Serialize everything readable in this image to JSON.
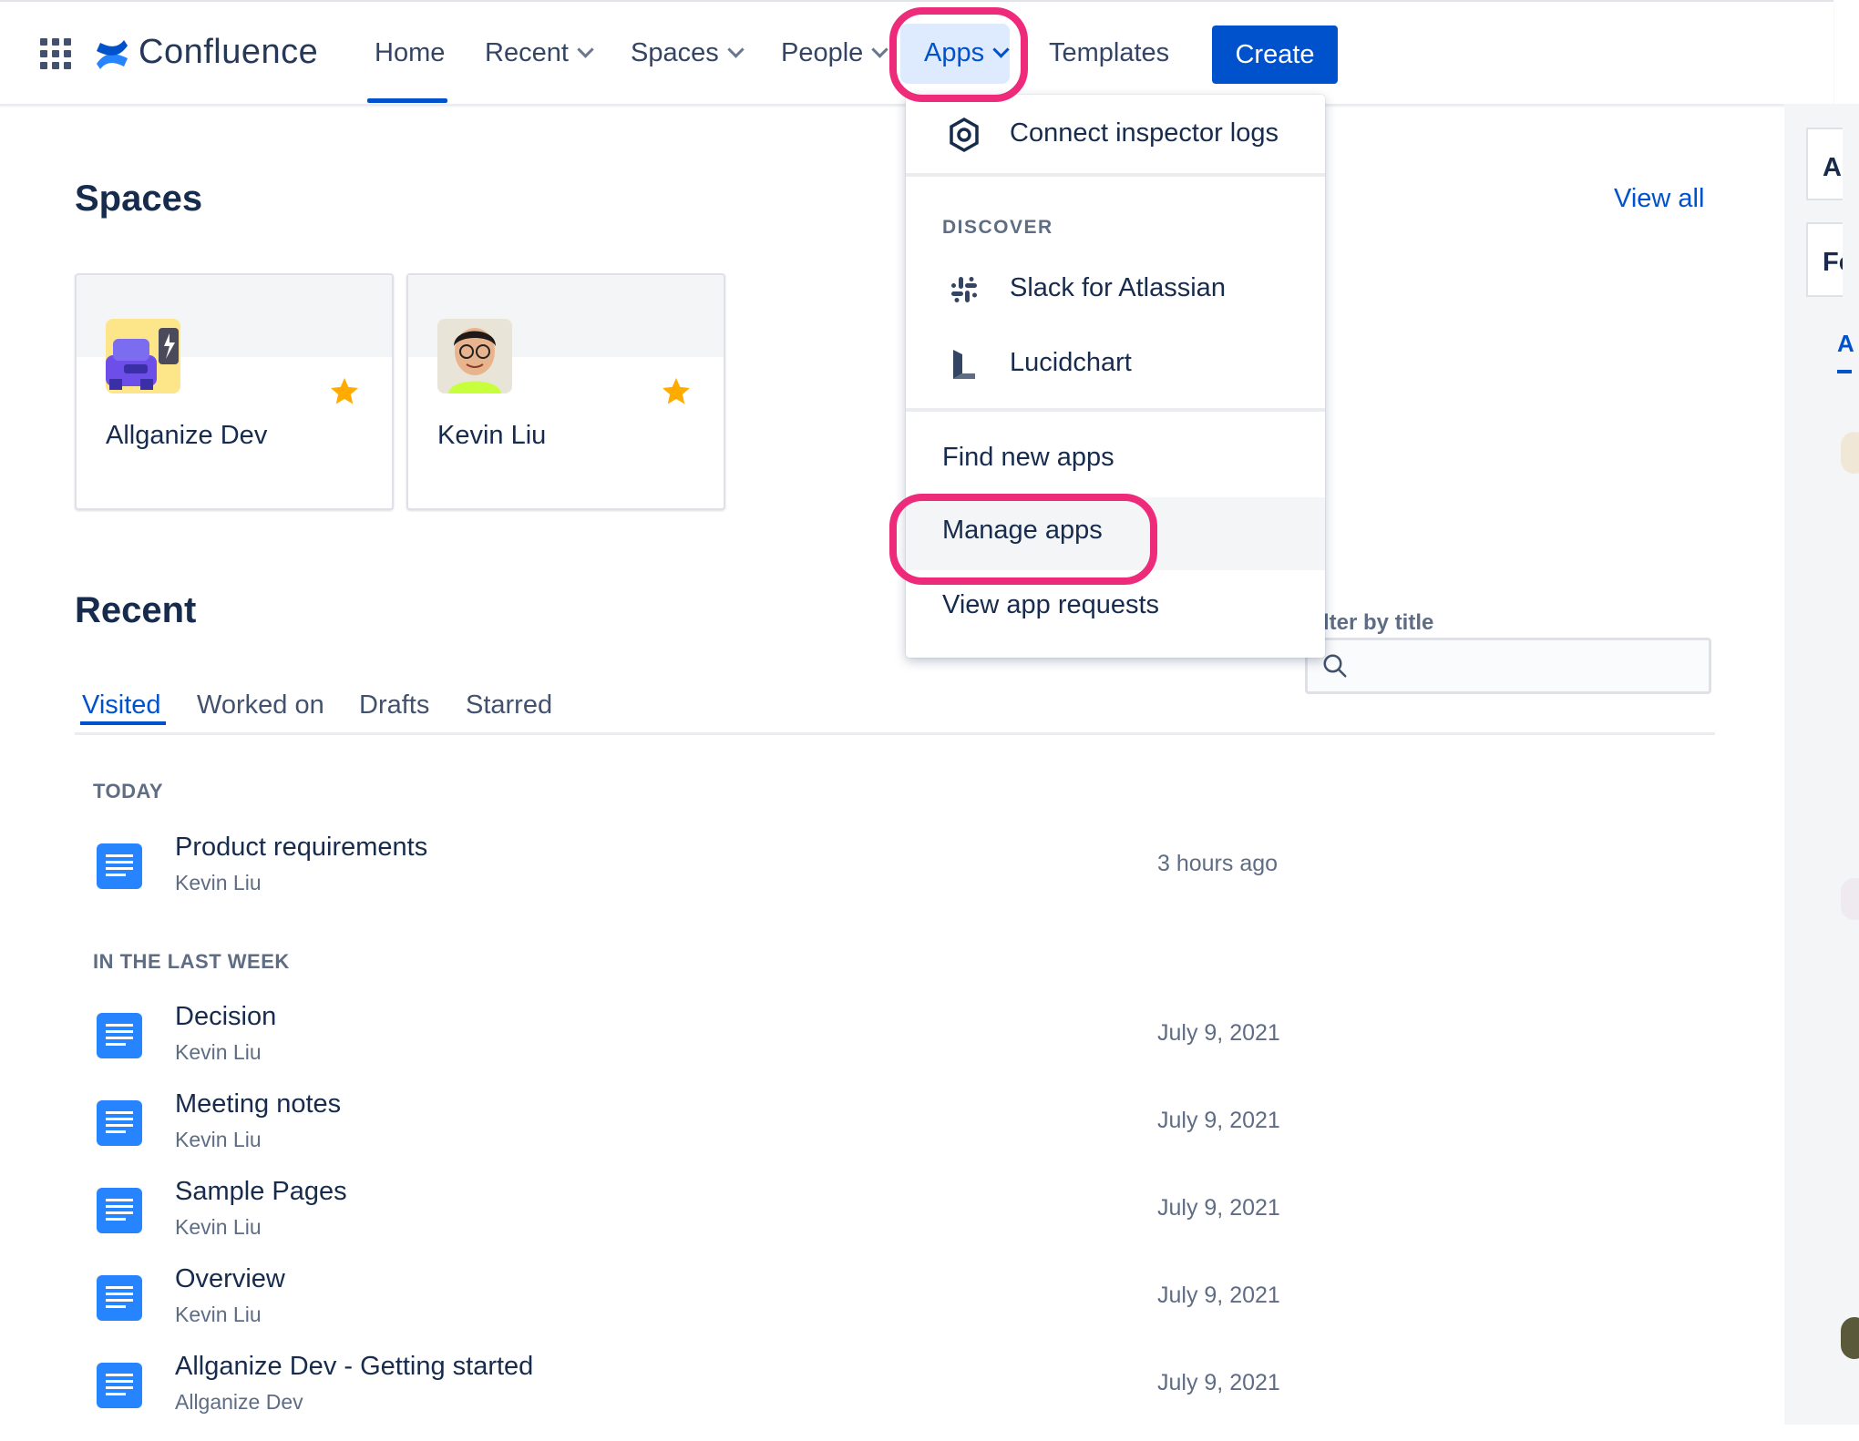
{
  "header": {
    "product_name": "Confluence",
    "nav": {
      "home": "Home",
      "recent": "Recent",
      "spaces": "Spaces",
      "people": "People",
      "apps": "Apps",
      "templates": "Templates"
    },
    "create_label": "Create"
  },
  "apps_menu": {
    "top_item": "Connect inspector logs",
    "discover_heading": "DISCOVER",
    "discover_items": [
      "Slack for Atlassian",
      "Lucidchart"
    ],
    "actions": [
      "Find new apps",
      "Manage apps",
      "View app requests"
    ]
  },
  "spaces": {
    "heading": "Spaces",
    "view_all": "View all",
    "cards": [
      {
        "name": "Allganize Dev",
        "starred": true
      },
      {
        "name": "Kevin Liu",
        "starred": true
      }
    ]
  },
  "recent": {
    "heading": "Recent",
    "tabs": [
      "Visited",
      "Worked on",
      "Drafts",
      "Starred"
    ],
    "active_tab": "Visited",
    "filter_label": "lter by title",
    "filter_placeholder": "",
    "groups": [
      {
        "label": "TODAY",
        "items": [
          {
            "title": "Product requirements",
            "space": "Kevin Liu",
            "date": "3 hours ago"
          }
        ]
      },
      {
        "label": "IN THE LAST WEEK",
        "items": [
          {
            "title": "Decision",
            "space": "Kevin Liu",
            "date": "July 9, 2021"
          },
          {
            "title": "Meeting notes",
            "space": "Kevin Liu",
            "date": "July 9, 2021"
          },
          {
            "title": "Sample Pages",
            "space": "Kevin Liu",
            "date": "July 9, 2021"
          },
          {
            "title": "Overview",
            "space": "Kevin Liu",
            "date": "July 9, 2021"
          },
          {
            "title": "Allganize Dev - Getting started",
            "space": "Allganize Dev",
            "date": "July 9, 2021"
          }
        ]
      }
    ]
  },
  "right_rail": {
    "card1_fragment": "Ar",
    "card2_fragment": "Fe",
    "link_fragment": "A"
  },
  "colors": {
    "brand_blue": "#0052cc",
    "highlight_pink": "#ee2a7b",
    "star_yellow": "#ffab00"
  },
  "icons": [
    "app-switcher-icon",
    "confluence-logo-icon",
    "chevron-down-icon",
    "hexagon-ring-icon",
    "slack-icon",
    "lucidchart-icon",
    "search-icon",
    "star-icon",
    "page-icon"
  ]
}
